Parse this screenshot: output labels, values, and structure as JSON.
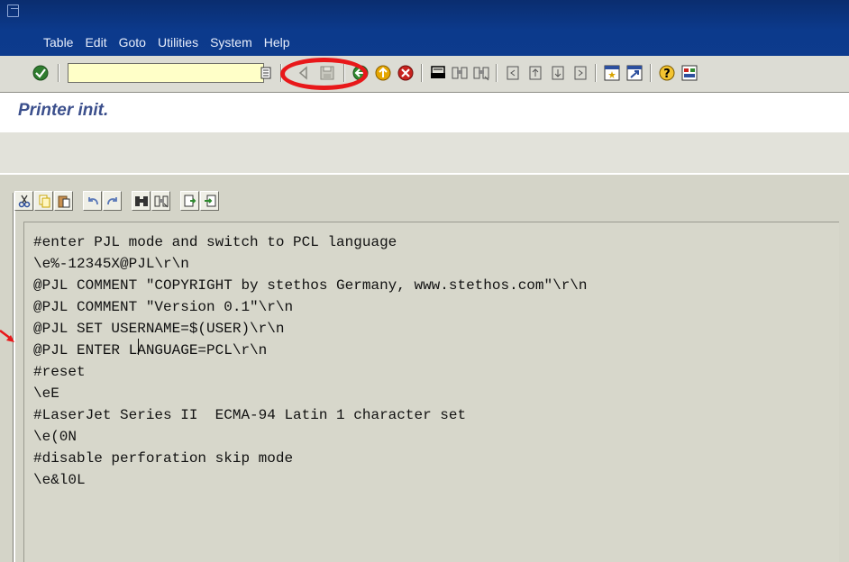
{
  "menu": {
    "items": [
      "Table",
      "Edit",
      "Goto",
      "Utilities",
      "System",
      "Help"
    ]
  },
  "toolbar": {
    "command_field_value": "",
    "icons": [
      "enter-icon",
      "dropdown-icon",
      "back-arrow-icon",
      "save-icon",
      "back-icon",
      "exit-icon",
      "cancel-icon",
      "print-icon",
      "find-icon",
      "find-next-icon",
      "first-page-icon",
      "previous-page-icon",
      "next-page-icon",
      "last-page-icon",
      "create-session-icon",
      "shortcut-icon",
      "help-icon",
      "layout-icon"
    ]
  },
  "title": {
    "text": "Printer init."
  },
  "editor": {
    "toolbar_icons": [
      "cut-icon",
      "copy-icon",
      "paste-icon",
      "undo-icon",
      "redo-icon",
      "find-icon",
      "find-next-icon",
      "upload-icon",
      "download-icon"
    ],
    "lines": [
      "#enter PJL mode and switch to PCL language",
      "\\e%-12345X@PJL\\r\\n",
      "@PJL COMMENT \"COPYRIGHT by stethos Germany, www.stethos.com\"\\r\\n",
      "@PJL COMMENT \"Version 0.1\"\\r\\n",
      "@PJL SET USERNAME=$(USER)\\r\\n",
      "@PJL ENTER LANGUAGE=PCL\\r\\n",
      "#reset",
      "\\eE",
      "#LaserJet Series II  ECMA-94 Latin 1 character set",
      "\\e(0N",
      "#disable perforation skip mode",
      "\\e&l0L"
    ]
  },
  "colors": {
    "title_bar": "#0c3a8c",
    "toolbar_bg": "#dcdcd4",
    "title_text": "#3b4f8c",
    "editor_bg": "#d7d7cb",
    "highlight": "#e8181a"
  }
}
